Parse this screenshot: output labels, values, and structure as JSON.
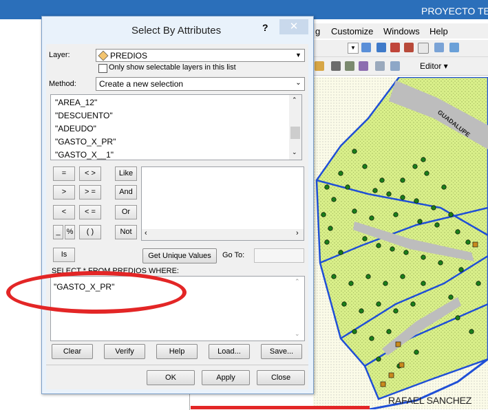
{
  "app": {
    "window_title": "PROYECTO TE",
    "menus": [
      "g",
      "Customize",
      "Windows",
      "Help"
    ],
    "editor_label": "Editor ▾",
    "map_labels": {
      "street_top": "GUADALUPE",
      "bottom": "RAFAEL SANCHEZ"
    }
  },
  "dialog": {
    "title": "Select By Attributes",
    "help": "?",
    "close": "✕",
    "layer_label": "Layer:",
    "layer_value": "PREDIOS",
    "only_selectable_label": "Only show selectable layers in this list",
    "method_label": "Method:",
    "method_value": "Create a new selection",
    "fields": [
      "\"AREA_12\"",
      "\"DESCUENTO\"",
      "\"ADEUDO\"",
      "\"GASTO_X_PR\"",
      "\"GASTO_X__1\""
    ],
    "operators": {
      "eq": "=",
      "ne": "< >",
      "like": "Like",
      "gt": ">",
      "ge": "> =",
      "and": "And",
      "lt": "<",
      "le": "< =",
      "or": "Or",
      "underscore": "_",
      "percent": "%",
      "parens": "( )",
      "not": "Not",
      "is": "Is"
    },
    "get_unique_values": "Get Unique Values",
    "go_to_label": "Go To:",
    "where_label": "SELECT * FROM PREDIOS WHERE:",
    "expression": "\"GASTO_X_PR\"",
    "buttons": {
      "clear": "Clear",
      "verify": "Verify",
      "help": "Help",
      "load": "Load...",
      "save": "Save..."
    },
    "footer": {
      "ok": "OK",
      "apply": "Apply",
      "close": "Close"
    }
  },
  "colors": {
    "annotation": "#e32626",
    "map_fill": "#d9ef8a",
    "map_line": "#1f4fd6",
    "map_dot": "#1a7d1a"
  }
}
